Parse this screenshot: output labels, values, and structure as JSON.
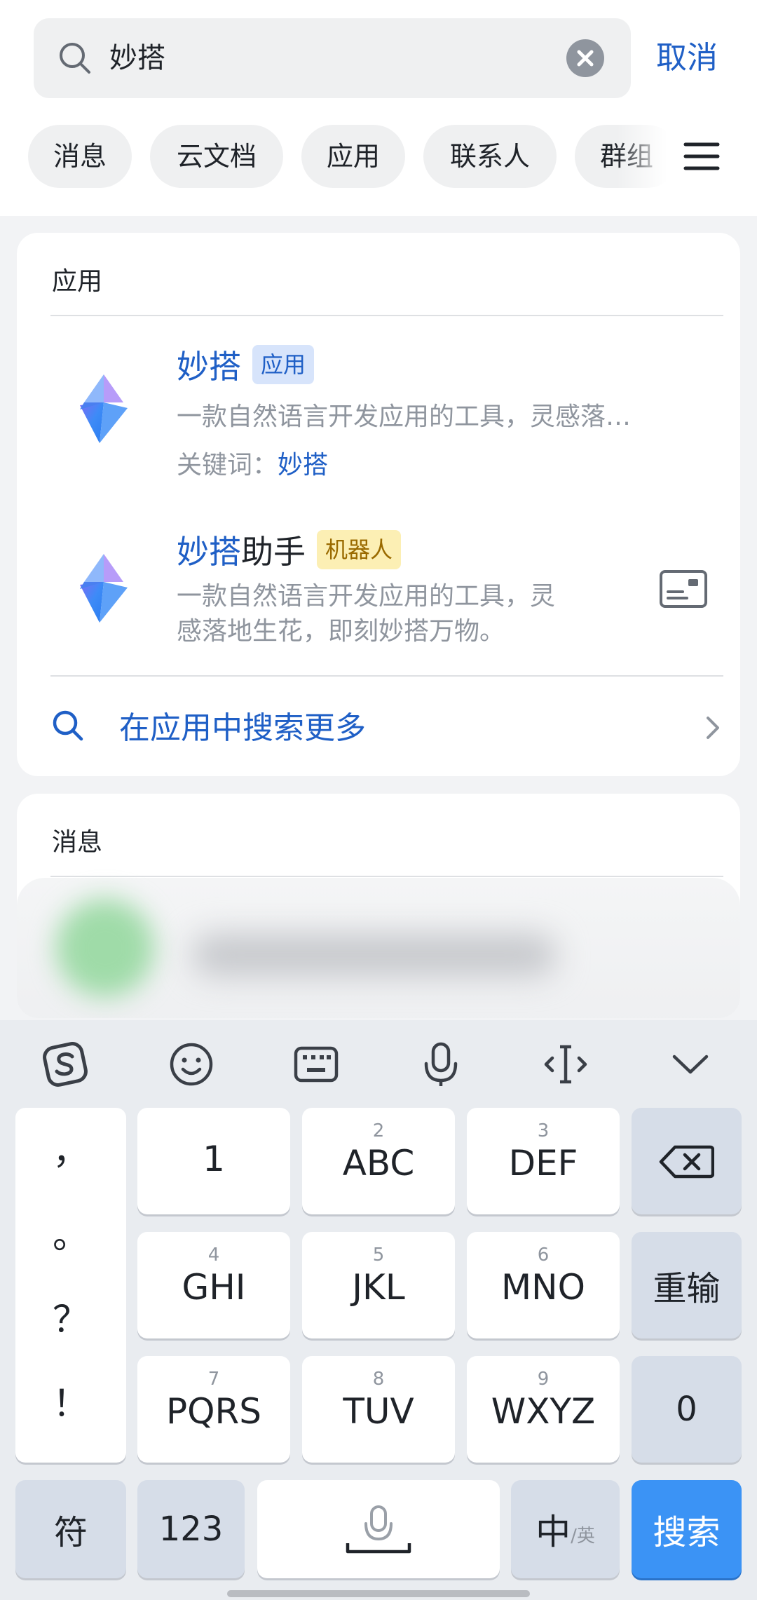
{
  "search": {
    "query": "妙搭",
    "cancel_label": "取消"
  },
  "filters": [
    "消息",
    "云文档",
    "应用",
    "联系人",
    "群组"
  ],
  "apps_section": {
    "title": "应用",
    "items": [
      {
        "name_highlight": "妙搭",
        "name_rest": "",
        "badge": "应用",
        "description": "一款自然语言开发应用的工具，灵感落…",
        "keyword_label": "关键词：",
        "keyword_value": "妙搭"
      },
      {
        "name_highlight": "妙搭",
        "name_rest": "助手",
        "badge": "机器人",
        "description_line1": "一款自然语言开发应用的工具，灵",
        "description_line2": "感落地生花，即刻妙搭万物。"
      }
    ],
    "more_label": "在应用中搜索更多"
  },
  "messages_section": {
    "title": "消息"
  },
  "keyboard": {
    "toolbar_icons": [
      "sogou-logo-icon",
      "emoji-icon",
      "keyboard-icon",
      "microphone-icon",
      "cursor-icon",
      "chevron-down-icon"
    ],
    "punctuation": [
      "，",
      "。",
      "？",
      "！"
    ],
    "keys": {
      "k1": {
        "num": "",
        "label": "1"
      },
      "k2": {
        "num": "2",
        "label": "ABC"
      },
      "k3": {
        "num": "3",
        "label": "DEF"
      },
      "k4": {
        "num": "4",
        "label": "GHI"
      },
      "k5": {
        "num": "5",
        "label": "JKL"
      },
      "k6": {
        "num": "6",
        "label": "MNO"
      },
      "k7": {
        "num": "7",
        "label": "PQRS"
      },
      "k8": {
        "num": "8",
        "label": "TUV"
      },
      "k9": {
        "num": "9",
        "label": "WXYZ"
      }
    },
    "reenter_label": "重输",
    "zero_label": "0",
    "symbol_label": "符",
    "numeric_label": "123",
    "lang_main": "中",
    "lang_sub": "/英",
    "search_label": "搜索"
  }
}
